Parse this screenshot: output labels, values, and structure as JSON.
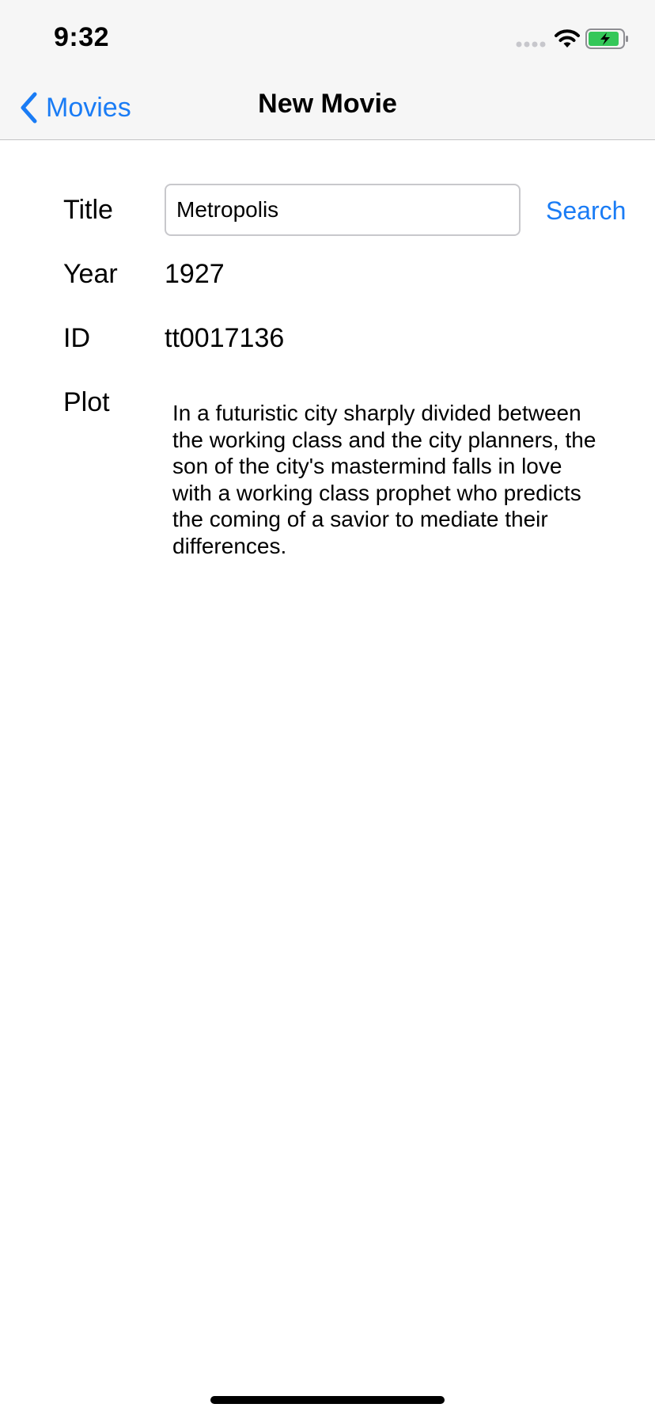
{
  "status_bar": {
    "time": "9:32",
    "icons": [
      "signal-dots-icon",
      "wifi-icon",
      "battery-charging-icon"
    ]
  },
  "nav": {
    "back_label": "Movies",
    "title": "New Movie"
  },
  "form": {
    "title_label": "Title",
    "title_value": "Metropolis",
    "search_label": "Search",
    "year_label": "Year",
    "year_value": "1927",
    "id_label": "ID",
    "id_value": "tt0017136",
    "plot_label": "Plot",
    "plot_value": "In a futuristic city sharply divided between the working class and the city planners, the son of the city's mastermind falls in love with a working class prophet who predicts the coming of a savior to mediate their differences."
  },
  "colors": {
    "accent": "#1a7cf5",
    "bar_background": "#f6f6f6",
    "battery_fill": "#34c759"
  }
}
